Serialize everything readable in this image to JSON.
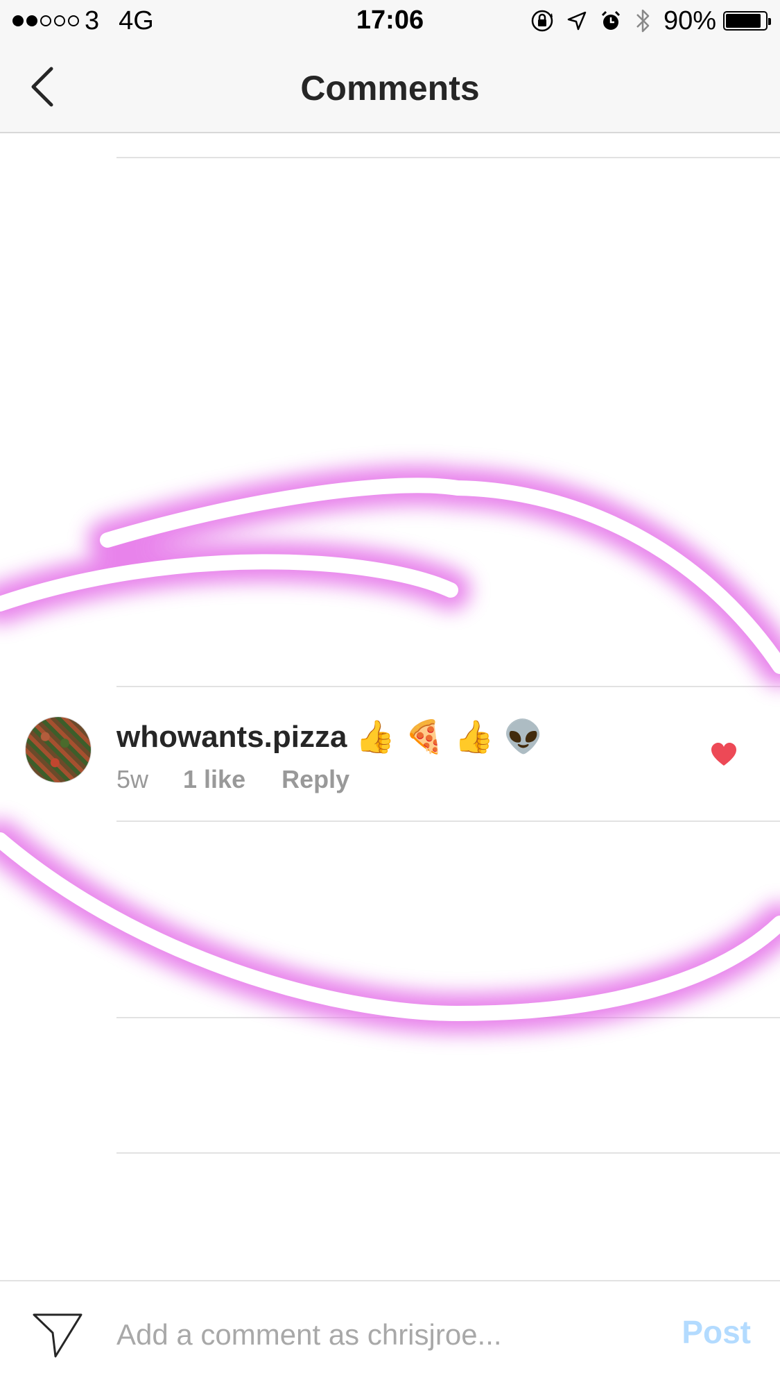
{
  "status_bar": {
    "signal": {
      "filled": 2,
      "total": 5
    },
    "carrier": "3",
    "network": "4G",
    "time": "17:06",
    "battery_percent": "90%",
    "battery_level": 0.9,
    "icons": [
      "orientation-lock-icon",
      "location-arrow-icon",
      "alarm-icon",
      "bluetooth-icon",
      "battery-icon"
    ]
  },
  "nav": {
    "title": "Comments",
    "back_icon": "chevron-left-icon"
  },
  "comment": {
    "username": "whowants.pizza",
    "text": "👍🍕👍👽",
    "time": "5w",
    "likes": "1 like",
    "reply_label": "Reply",
    "liked": true,
    "heart_color": "#ed4956"
  },
  "composer": {
    "placeholder": "Add a comment as chrisjroe...",
    "value": "",
    "post_label": "Post",
    "post_color": "#b3dbff",
    "send_icon": "paper-plane-icon"
  },
  "annotation": {
    "style": "neon-ellipse",
    "glow_color": "#e46ee8"
  }
}
